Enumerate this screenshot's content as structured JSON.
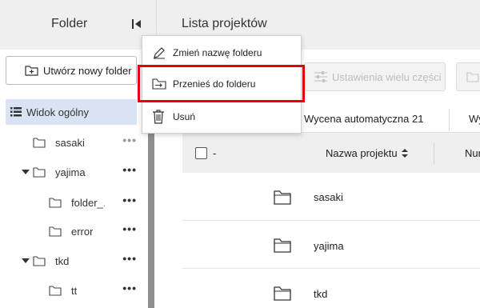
{
  "sidebar": {
    "title": "Folder",
    "new_folder_label": "Utwórz nowy folder",
    "items": [
      {
        "label": "Widok ogólny",
        "dots": ""
      },
      {
        "label": "sasaki",
        "dots": "•••"
      },
      {
        "label": "yajima",
        "dots": "•••"
      },
      {
        "label": "folder_…",
        "dots": "•••"
      },
      {
        "label": "error",
        "dots": "•••"
      },
      {
        "label": "tkd",
        "dots": "•••"
      },
      {
        "label": "tt",
        "dots": "•••"
      }
    ]
  },
  "main": {
    "title": "Lista projektów",
    "toolbar": {
      "bulk_settings_label": "Ustawienia wielu części"
    },
    "tabs": [
      "Wycena automatyczna 21",
      "Wy"
    ],
    "table": {
      "check_label": "-",
      "name_header": "Nazwa projektu",
      "num_header": "Num",
      "rows": [
        "sasaki",
        "yajima",
        "tkd"
      ]
    }
  },
  "context_menu": {
    "items": [
      {
        "label": "Zmień nazwę folderu",
        "icon": "pencil-icon"
      },
      {
        "label": "Przenieś do folderu",
        "icon": "move-folder-icon"
      },
      {
        "label": "Usuń",
        "icon": "trash-icon"
      }
    ]
  },
  "colors": {
    "header_bg": "#efefef",
    "active_item_bg": "#d9e3f3",
    "highlight": "#e2000f"
  }
}
